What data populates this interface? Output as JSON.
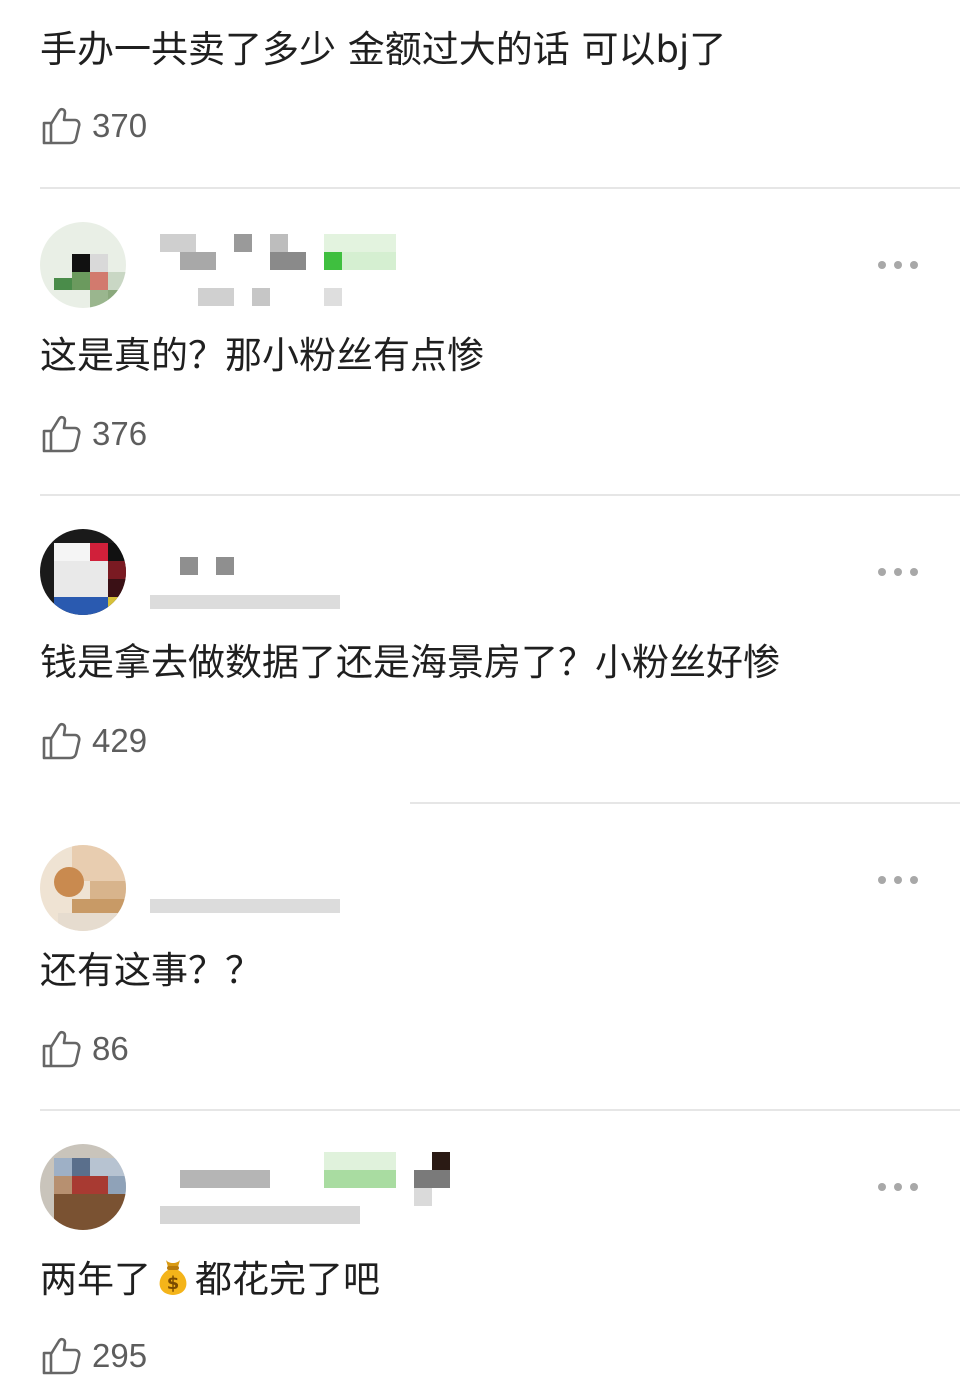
{
  "comments": [
    {
      "text": "手办一共卖了多少 金额过大的话 可以bj了",
      "likes": "370"
    },
    {
      "text": "这是真的？那小粉丝有点惨",
      "likes": "376"
    },
    {
      "text": "钱是拿去做数据了还是海景房了？小粉丝好惨",
      "likes": "429"
    },
    {
      "text": "还有这事？？",
      "likes": "86"
    },
    {
      "text_before": "两年了",
      "emoji": "money-bag",
      "text_after": "都花完了吧",
      "likes": "295"
    }
  ],
  "colors": {
    "text": "#1f1f1f",
    "muted": "#5d5d5d",
    "divider": "#e6e6e6",
    "more_dots": "#a8a8a8"
  },
  "icons": {
    "like": "thumbs-up-icon",
    "more": "more-dots-icon"
  }
}
